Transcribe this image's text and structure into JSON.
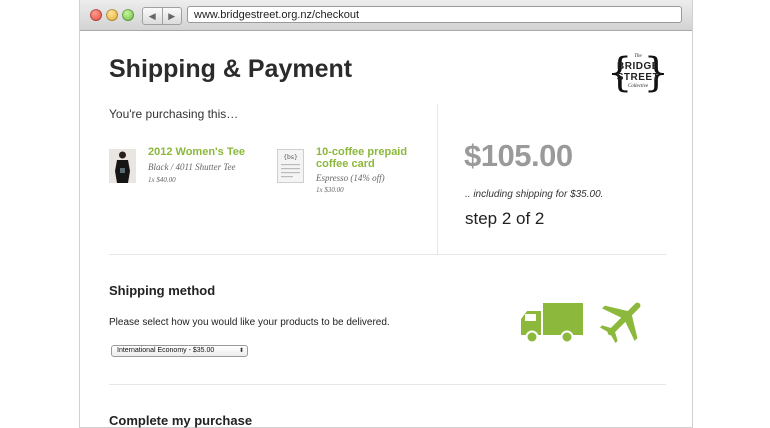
{
  "browser": {
    "url": "www.bridgestreet.org.nz/checkout",
    "back_icon": "◀",
    "forward_icon": "▶"
  },
  "page": {
    "title": "Shipping & Payment"
  },
  "logo": {
    "the": "The",
    "line1": "BRIDGE",
    "line2": "STREET",
    "collective": "Collective"
  },
  "purchase": {
    "label": "You're purchasing this…",
    "items": [
      {
        "name": "2012 Women's Tee",
        "variant": "Black / 4011 Shutter Tee",
        "qty": "1x $40.00"
      },
      {
        "name": "10-coffee prepaid coffee card",
        "variant": "Espresso (14% off)",
        "qty": "1x $30.00"
      }
    ],
    "total": "$105.00",
    "shipping_note": ".. including shipping for $35.00.",
    "step": "step 2 of 2"
  },
  "shipping": {
    "title": "Shipping method",
    "description": "Please select how you would like your products to be delivered.",
    "selected_option": "International Economy - $35.00",
    "accent_color": "#8cb83b"
  },
  "complete": {
    "title": "Complete my purchase"
  }
}
